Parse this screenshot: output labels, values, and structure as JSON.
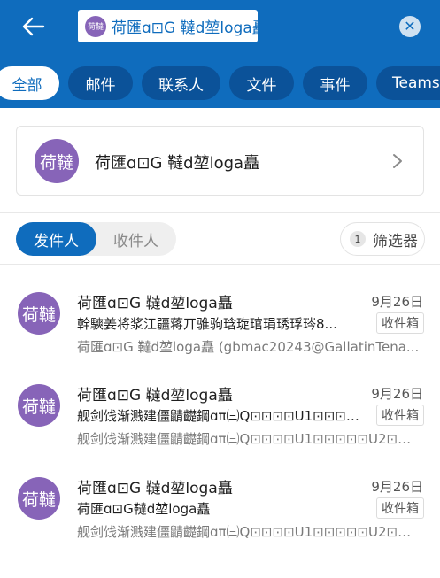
{
  "search": {
    "chip_avatar": "荷韃",
    "chip_text": "荷匯ɑ⊡G 韃d堃loga矗"
  },
  "tabs": [
    {
      "label": "全部"
    },
    {
      "label": "邮件"
    },
    {
      "label": "联系人"
    },
    {
      "label": "文件"
    },
    {
      "label": "事件"
    },
    {
      "label": "Teams"
    }
  ],
  "contact": {
    "avatar_text": "荷韃",
    "name": "荷匯ɑ⊡G 韃d堃loga矗"
  },
  "segment": {
    "from_label": "发件人",
    "to_label": "收件人"
  },
  "filter": {
    "count": "1",
    "label": "筛选器"
  },
  "mails": [
    {
      "avatar_text": "荷韃",
      "sender": "荷匯ɑ⊡G 韃d堃loga矗",
      "date": "9月26日",
      "subject": "幹騻姜将浆江疆蒋丌骓驹琀琁琯琄琇琈琌8...",
      "folder": "收件箱",
      "preview": "荷匯ɑ⊡G 韃d堃loga矗 (gbmac20243@GallatinTena..."
    },
    {
      "avatar_text": "荷韃",
      "sender": "荷匯ɑ⊡G 韃d堃loga矗",
      "date": "9月26日",
      "subject": "舰剑饯渐溅建僵鼱齼鋼ɑπ㈢Q⊡⊡⊡⊡U1⊡⊡⊡⊡⊡U...",
      "folder": "收件箱",
      "preview": "舰剑饯渐溅建僵鼱齼鋼ɑπ㈢Q⊡⊡⊡⊡U1⊡⊡⊡⊡⊡U2⊡⊡⊡⊡⊡..."
    },
    {
      "avatar_text": "荷韃",
      "sender": "荷匯ɑ⊡G 韃d堃loga矗",
      "date": "9月26日",
      "subject": "荷匯ɑ⊡G韃d堃loga矗",
      "folder": "收件箱",
      "preview": "舰剑饯渐溅建僵鼱齼鋼ɑπ㈢Q⊡⊡⊡⊡U1⊡⊡⊡⊡⊡U2⊡⊡⊡⊡⊡..."
    }
  ],
  "colors": {
    "brand": "#0f6cbd",
    "avatar": "#8764b8"
  },
  "icons": {
    "back": "arrow-left-icon",
    "clear": "close-circle-icon",
    "chevron": "chevron-right-icon"
  }
}
